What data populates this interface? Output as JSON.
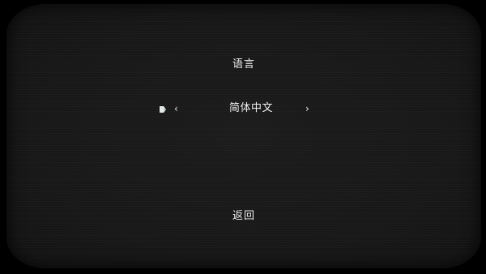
{
  "menu": {
    "title": "语言",
    "language": {
      "value": "简体中文",
      "prev_arrow": "‹",
      "next_arrow": "›",
      "cursor_icon": "selector-cursor-icon"
    },
    "back_label": "返回"
  },
  "colors": {
    "background": "#000000",
    "panel": "#191919",
    "text": "#f0f0f0",
    "cursor": "#e8e8e8"
  }
}
